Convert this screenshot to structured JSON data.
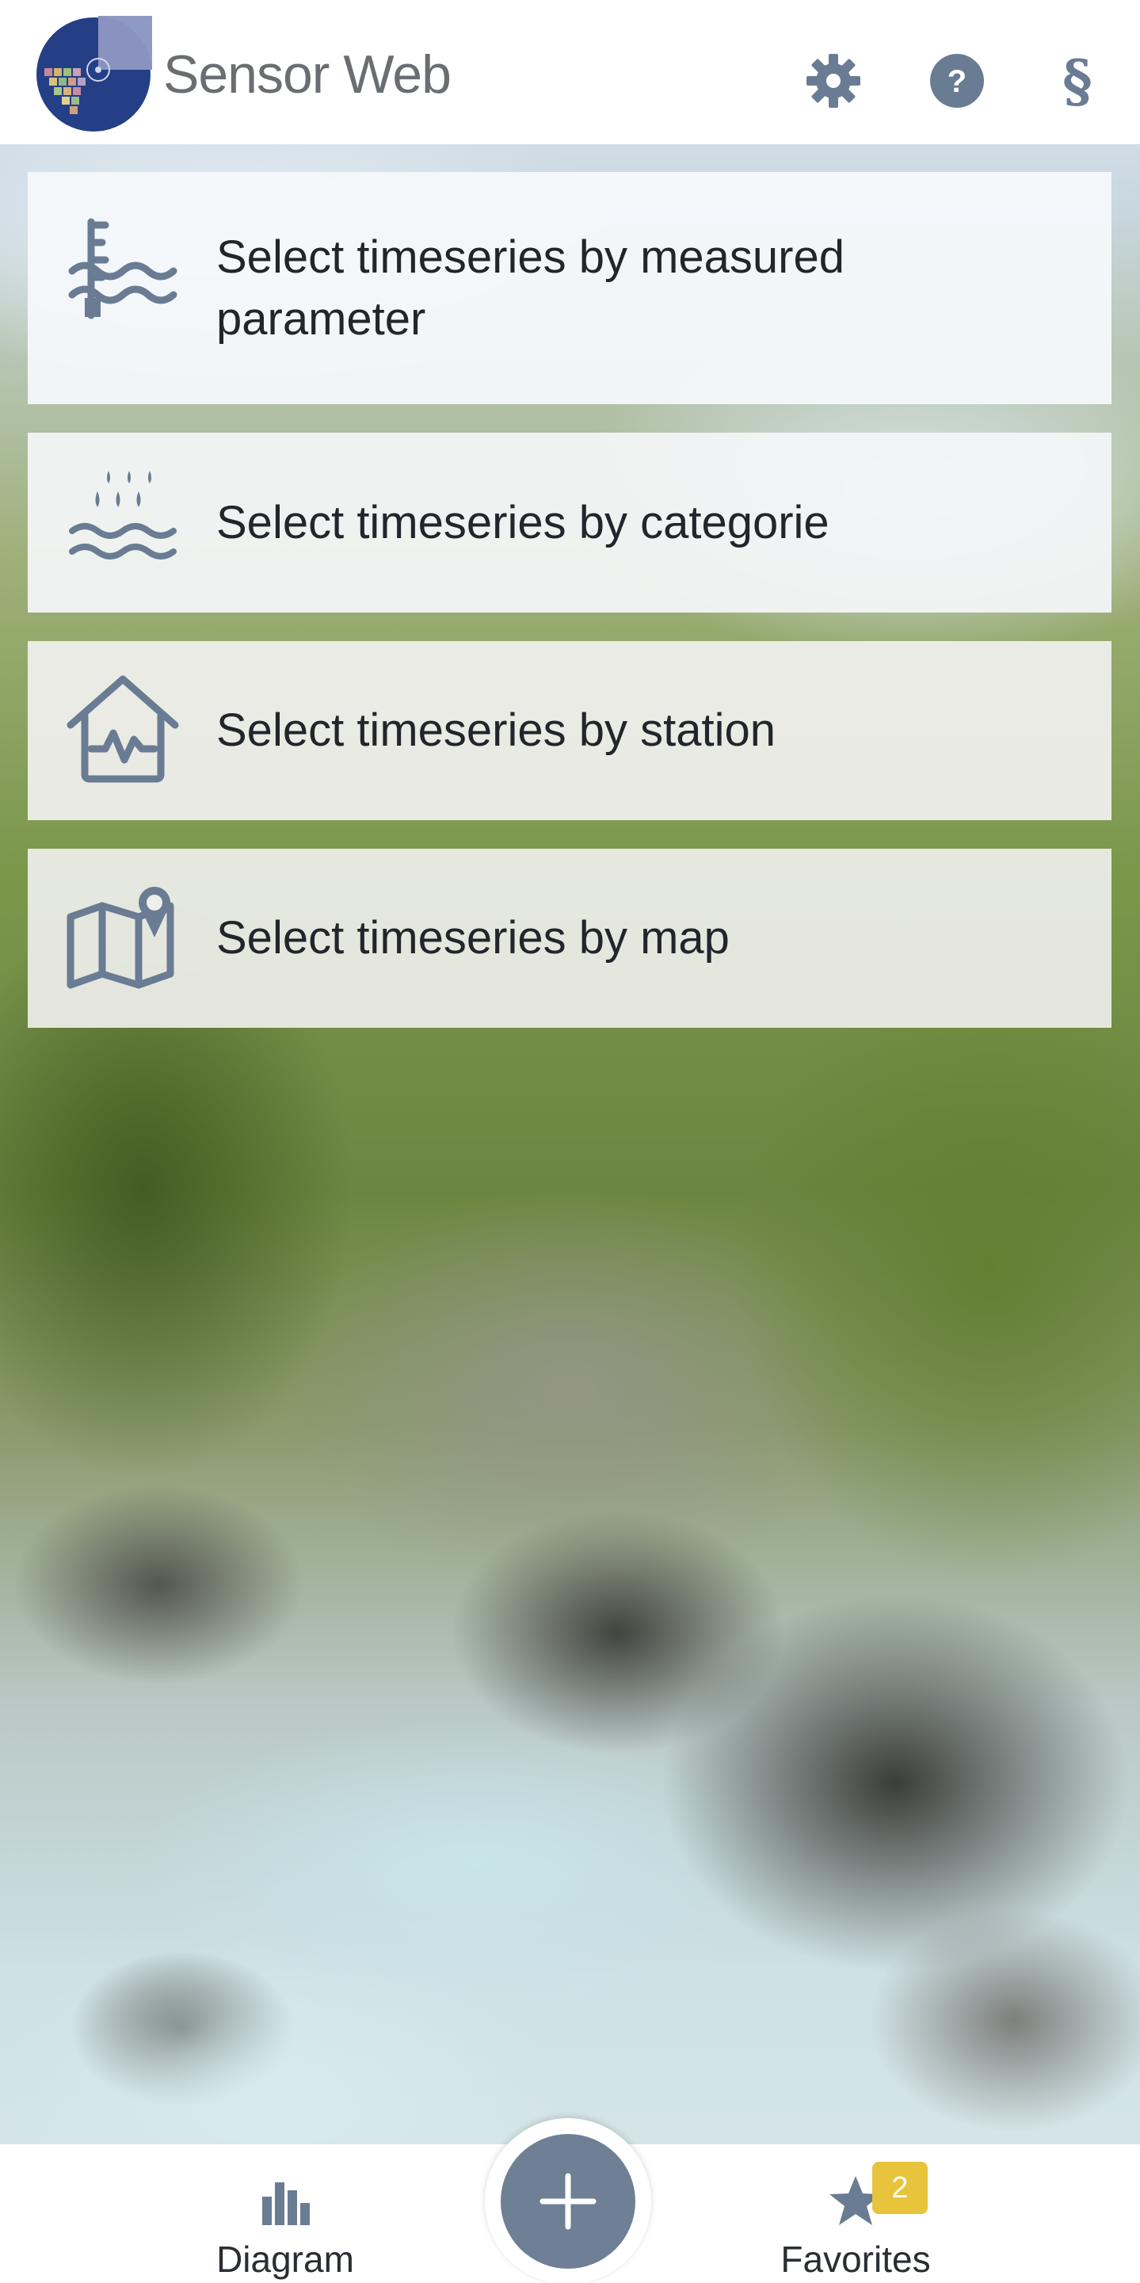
{
  "header": {
    "brand_name": "Sensor Web",
    "actions": [
      {
        "name": "settings",
        "icon": "gear-icon"
      },
      {
        "name": "help",
        "icon": "question-mark-icon",
        "glyph": "?"
      },
      {
        "name": "legal",
        "icon": "section-sign-icon",
        "glyph": "§"
      }
    ]
  },
  "menu": {
    "items": [
      {
        "label": "Select timeseries by measured parameter",
        "icon": "water-gauge-icon"
      },
      {
        "label": "Select timeseries by categorie",
        "icon": "rain-waves-icon"
      },
      {
        "label": "Select timeseries by station",
        "icon": "station-house-icon"
      },
      {
        "label": "Select timeseries by map",
        "icon": "map-pin-icon"
      }
    ]
  },
  "bottom_nav": {
    "diagram_label": "Diagram",
    "add_icon": "plus-icon",
    "favorites_label": "Favorites",
    "favorites_count": "2"
  },
  "colors": {
    "icon": "#6a7c93",
    "fab": "#6e7f96",
    "badge": "#e8c43c",
    "text": "#22262b"
  }
}
